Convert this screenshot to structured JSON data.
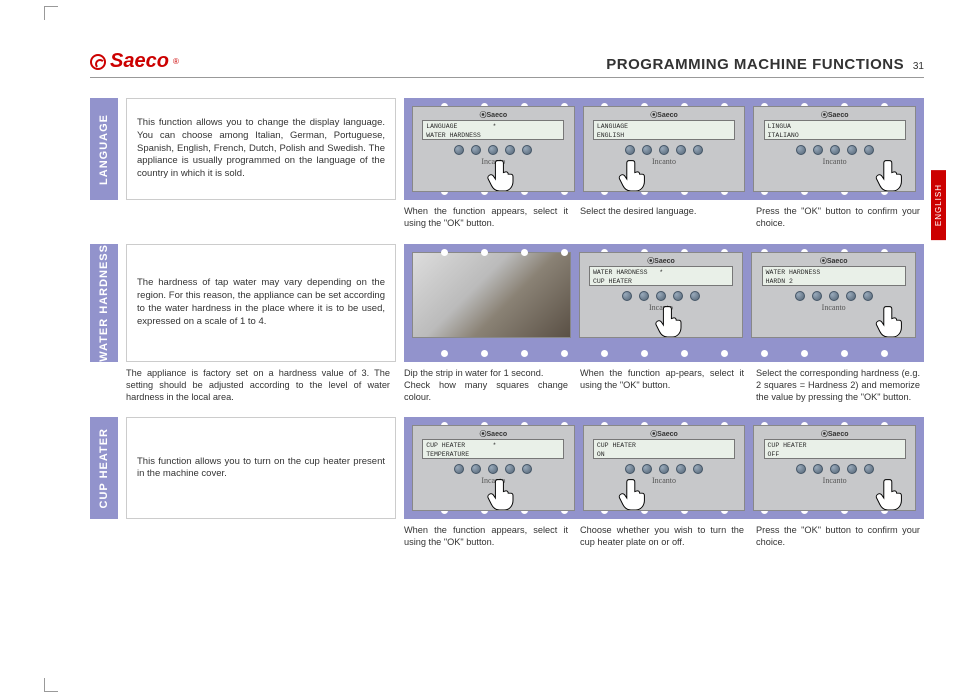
{
  "brand": "Saeco",
  "header_title": "PROGRAMMING MACHINE FUNCTIONS",
  "page_number": "31",
  "side_tab": "ENGLISH",
  "sections": {
    "language": {
      "label": "LANGUAGE",
      "description": "This function allows you to change the display language. You can choose among Italian, German, Portuguese, Spanish, English, French, Dutch, Polish and Swedish. The appliance is usually programmed on the language of the country in which it is sold.",
      "panels": [
        {
          "lcd": "LANGUAGE         *\nWATER HARDNESS",
          "hand": "m"
        },
        {
          "lcd": "LANGUAGE\nENGLISH",
          "hand": "l"
        },
        {
          "lcd": "LINGUA\nITALIANO",
          "hand": "r"
        }
      ],
      "captions": [
        "When the function ap­pears, select it using the \"OK\" button.",
        "Select the desired lan­guage.",
        "Press the \"OK\" button to confirm your choice."
      ]
    },
    "water": {
      "label": "WATER HARDNESS",
      "description": "The hardness of tap water may vary depending on the region. For this reason, the appliance can be set according to the water hardness in the place where it is to be used, expressed on a scale of 1 to 4.",
      "sub_description": "The appliance is factory set on a hardness value of 3. The setting should be adjusted according to the level of water hardness in the local area.",
      "panels": [
        {
          "type": "photo"
        },
        {
          "lcd": "WATER HARDNESS   *\nCUP HEATER",
          "hand": "m"
        },
        {
          "lcd": "WATER HARDNESS\nHARDN 2",
          "hand": "r"
        }
      ],
      "captions": [
        "Dip the strip in water for 1 second.\nCheck how many squares change colour.",
        "When the function ap-pears, select it using the \"OK\" button.",
        "Select the corresponding hardness (e.g. 2 squares = Hardness 2) and memorize the value by pressing the \"OK\" button."
      ]
    },
    "cup": {
      "label": "CUP HEATER",
      "description": "This function allows you to turn on the cup heater present in the machine cover.",
      "panels": [
        {
          "lcd": "CUP HEATER       *\nTEMPERATURE",
          "hand": "m"
        },
        {
          "lcd": "CUP HEATER\nON",
          "hand": "l"
        },
        {
          "lcd": "CUP HEATER\nOFF",
          "hand": "r"
        }
      ],
      "captions": [
        "When the function ap­pears, select it using the \"OK\" button.",
        "Choose whether you wish to turn the cup heater plate on or off.",
        "Press the \"OK\" button to confirm your choice."
      ]
    }
  }
}
